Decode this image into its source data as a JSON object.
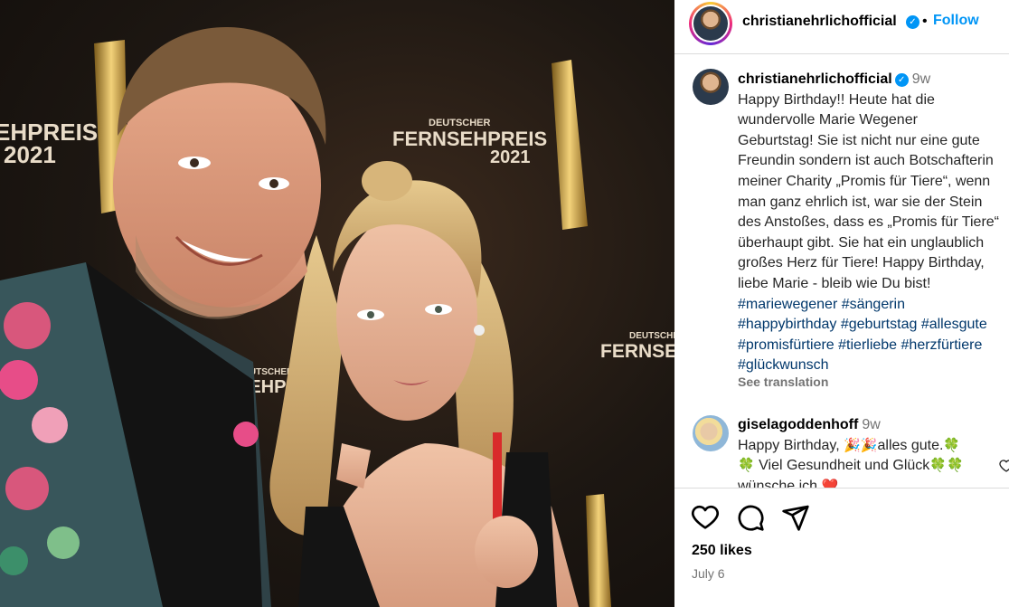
{
  "photo": {
    "backdrop_words": [
      "DEUTSCHER",
      "FERNSEHPREIS",
      "2021"
    ],
    "backdrop_partial_left": [
      "EHPREIS",
      "2021"
    ],
    "backdrop_partial_right": [
      "DEUTSCHER",
      "FERNSEH"
    ],
    "backdrop_partial_bottom": [
      "DEUTSCHER",
      "SEHPR"
    ]
  },
  "header": {
    "username": "christianehrlichofficial",
    "separator": "•",
    "follow_label": "Follow"
  },
  "caption": {
    "author": "christianehrlichofficial",
    "time": "9w",
    "lines": [
      "Happy Birthday!! Heute hat die",
      "wundervolle Marie Wegener",
      "Geburtstag! Sie ist nicht nur eine gute",
      "Freundin sondern ist auch Botschafterin",
      "meiner Charity „Promis für Tiere“, wenn",
      "man ganz ehrlich ist, war sie der Stein",
      "des Anstoßes, dass es „Promis für Tiere“",
      "überhaupt gibt. Sie hat ein unglaublich",
      "großes Herz für Tiere! Happy Birthday,",
      "liebe Marie - bleib wie Du bist!"
    ],
    "hashtag_lines": [
      "#mariewegener #sängerin",
      "#happybirthday #geburtstag #allesgute",
      "#promisfürtiere #tierliebe #herzfürtiere",
      "#glückwunsch"
    ],
    "see_translation": "See translation"
  },
  "comment": {
    "author": "giselagoddenhoff",
    "time": "9w",
    "line1_text_a": "Happy Birthday,",
    "line1_text_b": "alles gute.",
    "line2_text": "Viel Gesundheit und Glück",
    "line3_text": "wünsche ich",
    "emoji_party": "🎉",
    "emoji_clover": "🍀",
    "emoji_heart": "❤️"
  },
  "actions": {
    "likes": "250 likes",
    "date": "July 6"
  },
  "colors": {
    "accent": "#0095f6",
    "hashtag": "#00376b",
    "muted": "#737373"
  }
}
